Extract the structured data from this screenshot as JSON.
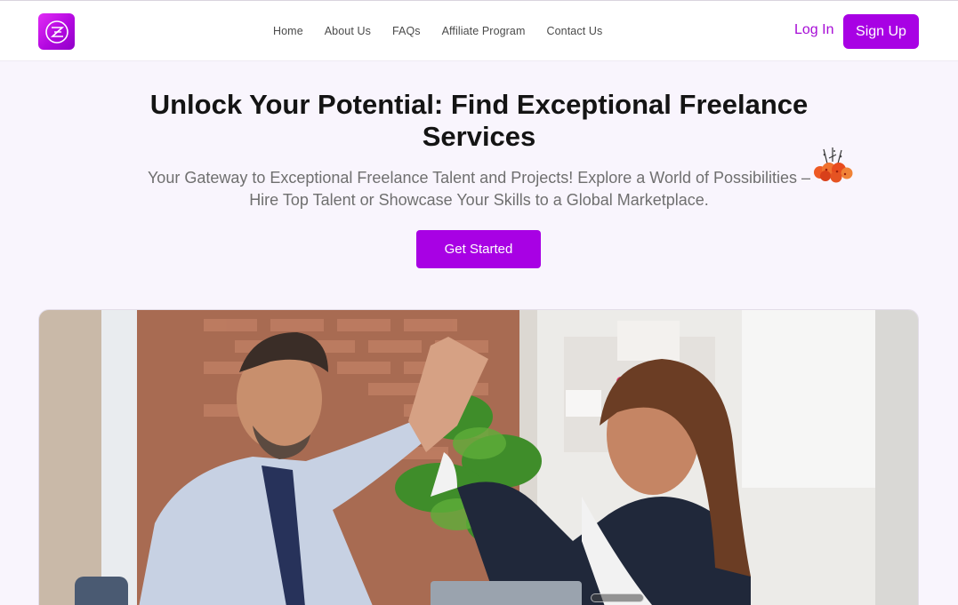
{
  "header": {
    "logo_icon": "brand-logo-icon",
    "nav": [
      {
        "label": "Home"
      },
      {
        "label": "About Us"
      },
      {
        "label": "FAQs"
      },
      {
        "label": "Affiliate Program"
      },
      {
        "label": "Contact Us"
      }
    ],
    "login_label": "Log In",
    "signup_label": "Sign Up"
  },
  "hero": {
    "title": "Unlock Your Potential: Find Exceptional Freelance Services",
    "subtitle": "Your Gateway to Exceptional Freelance Talent and Projects! Explore a World of Possibilities – Hire Top Talent or Showcase Your Skills to a Global Marketplace.",
    "cta_label": "Get Started",
    "decoration_icon": "celebration-icon",
    "image": "office-high-five-photo"
  },
  "colors": {
    "accent": "#a801e4",
    "link": "#a60cd6",
    "background": "#f9f5fd"
  }
}
